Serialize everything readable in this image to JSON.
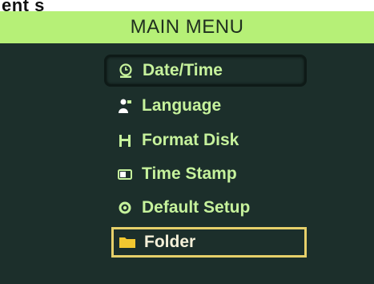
{
  "header": {
    "title": "MAIN MENU",
    "cut_text": "ent s"
  },
  "menu": {
    "items": [
      {
        "label": "Date/Time",
        "icon": "clock-icon",
        "state": "selected"
      },
      {
        "label": "Language",
        "icon": "language-icon",
        "state": "normal"
      },
      {
        "label": "Format Disk",
        "icon": "format-disk-icon",
        "state": "normal"
      },
      {
        "label": "Time Stamp",
        "icon": "time-stamp-icon",
        "state": "normal"
      },
      {
        "label": "Default Setup",
        "icon": "default-setup-icon",
        "state": "normal"
      },
      {
        "label": "Folder",
        "icon": "folder-icon",
        "state": "highlighted"
      }
    ]
  },
  "colors": {
    "title_bar": "#b6f077",
    "panel": "#1c2f2b",
    "text": "#c6f29c",
    "highlight_border": "#e6d06a",
    "folder_icon": "#f2c830"
  }
}
